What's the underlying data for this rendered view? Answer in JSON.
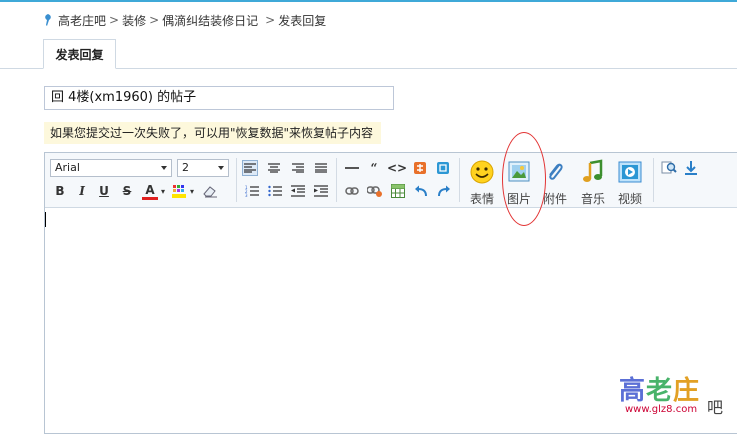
{
  "breadcrumb": {
    "items": [
      "高老庄吧",
      "装修",
      "偶滴纠结装修日记",
      "发表回复"
    ],
    "separator": ">"
  },
  "tab": {
    "label": "发表回复"
  },
  "subject": {
    "value": "回 4楼(xm1960) 的帖子"
  },
  "notice": {
    "text": "如果您提交过一次失败了，可以用\"恢复数据\"来恢复帖子内容"
  },
  "toolbar": {
    "font_family": "Arial",
    "font_size": "2",
    "bold": "B",
    "italic": "I",
    "underline": "U",
    "strike": "S",
    "font_color": "A",
    "big_buttons": [
      {
        "label": "表情",
        "icon": "smiley-icon"
      },
      {
        "label": "图片",
        "icon": "image-icon"
      },
      {
        "label": "附件",
        "icon": "paperclip-icon"
      },
      {
        "label": "音乐",
        "icon": "music-note-icon"
      },
      {
        "label": "视频",
        "icon": "video-icon"
      }
    ]
  },
  "watermark": {
    "chars": [
      "高",
      "老",
      "庄"
    ],
    "ba": "吧",
    "url": "www.glz8.com"
  },
  "colors": {
    "accent": "#3fa9d8",
    "notice_bg": "#fdf8dc",
    "highlight_circle": "#e23333"
  }
}
